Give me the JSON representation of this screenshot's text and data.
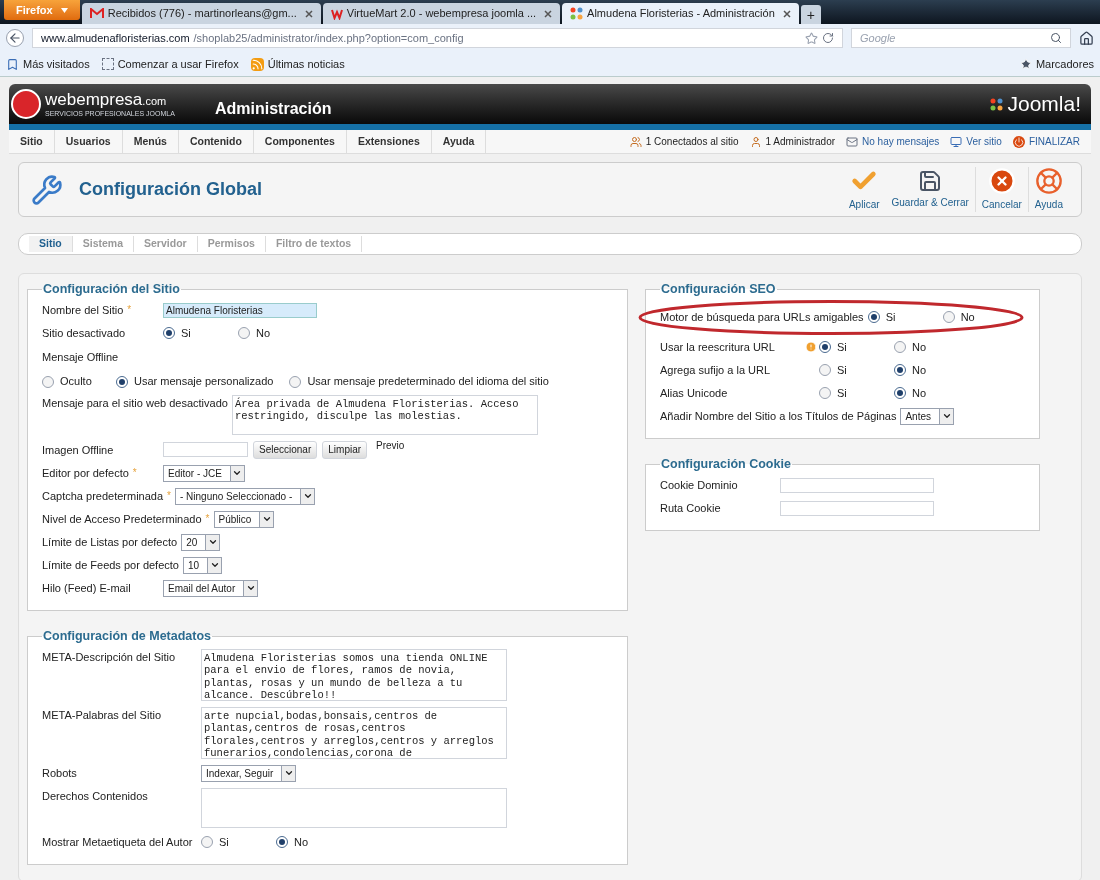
{
  "browser": {
    "menu_button": "Firefox",
    "tabs": [
      {
        "label": "Recibidos (776) - martinorleans@gm...",
        "kind": "mail",
        "selected": false
      },
      {
        "label": "VirtueMart 2.0 - webempresa joomla ...",
        "kind": "webempresa",
        "selected": false
      },
      {
        "label": "Almudena Floristerias - Administración",
        "kind": "joomla",
        "selected": true
      }
    ],
    "new_tab": "+",
    "url": {
      "host": "www.almudenafloristerias.com",
      "path": "/shoplab25/administrator/index.php?option=com_config"
    },
    "search": {
      "placeholder": "Google"
    },
    "bookmarks": [
      {
        "label": "Más visitados",
        "kind": "star"
      },
      {
        "label": "Comenzar a usar Firefox",
        "kind": "page"
      },
      {
        "label": "Últimas noticias",
        "kind": "rss"
      }
    ],
    "bookmarks_menu": "Marcadores"
  },
  "header": {
    "brand": "webempresa",
    "brand_suffix": ".com",
    "tagline": "SERVICIOS PROFESIONALES JOOMLA",
    "title": "Administración",
    "product": "Joomla!"
  },
  "menu": [
    "Sitio",
    "Usuarios",
    "Menús",
    "Contenido",
    "Componentes",
    "Extensiones",
    "Ayuda"
  ],
  "status": [
    {
      "label": "1 Conectados al sitio",
      "kind": "users"
    },
    {
      "label": "1 Administrador",
      "kind": "admin"
    },
    {
      "label": "No hay mensajes",
      "kind": "messages"
    },
    {
      "label": "Ver sitio",
      "kind": "site"
    },
    {
      "label": "FINALIZAR",
      "kind": "logout"
    }
  ],
  "toolbar": {
    "title": "Configuración Global",
    "buttons": [
      {
        "label": "Aplicar",
        "kind": "apply"
      },
      {
        "label": "Guardar & Cerrar",
        "kind": "save"
      },
      {
        "label": "Cancelar",
        "kind": "cancel"
      },
      {
        "label": "Ayuda",
        "kind": "help"
      }
    ]
  },
  "tabs": [
    {
      "label": "Sitio",
      "selected": true
    },
    {
      "label": "Sistema",
      "selected": false
    },
    {
      "label": "Servidor",
      "selected": false
    },
    {
      "label": "Permisos",
      "selected": false
    },
    {
      "label": "Filtro de textos",
      "selected": false
    }
  ],
  "left": [
    {
      "title": "Configuración del Sitio",
      "fields": [
        {
          "label": "Nombre del Sitio",
          "required": true,
          "kind": "text",
          "value": "Almudena Floristerias",
          "focused": true
        },
        {
          "label": "Sitio desactivado",
          "required": false,
          "kind": "radio",
          "options": [
            {
              "label": "Si",
              "selected": true
            },
            {
              "label": "No",
              "selected": false
            }
          ]
        },
        {
          "label": "Mensaje Offline",
          "required": false,
          "kind": "radio_block",
          "options": [
            {
              "label": "Oculto",
              "selected": false
            },
            {
              "label": "Usar mensaje personalizado",
              "selected": true
            },
            {
              "label": "Usar mensaje predeterminado del idioma del sitio",
              "selected": false
            }
          ]
        },
        {
          "label": "Mensaje para el sitio web desactivado",
          "required": false,
          "kind": "textarea",
          "value": "Área privada de Almudena Floristerias. Acceso restringido, disculpe las molestias."
        },
        {
          "label": "Imagen Offline",
          "required": false,
          "kind": "image",
          "buttons": [
            "Seleccionar",
            "Limpiar"
          ],
          "preview": "Previo"
        },
        {
          "label": "Editor por defecto",
          "required": true,
          "kind": "select",
          "value": "Editor - JCE"
        },
        {
          "label": "Captcha predeterminada",
          "required": true,
          "kind": "select",
          "value": "- Ninguno Seleccionado -"
        },
        {
          "label": "Nivel de Acceso Predeterminado",
          "required": true,
          "kind": "select",
          "value": "Público"
        },
        {
          "label": "Límite de Listas por defecto",
          "required": false,
          "kind": "select",
          "value": "20"
        },
        {
          "label": "Límite de Feeds por defecto",
          "required": false,
          "kind": "select",
          "value": "10"
        },
        {
          "label": "Hilo (Feed) E-mail",
          "required": false,
          "kind": "select",
          "value": "Email del Autor"
        }
      ]
    },
    {
      "title": "Configuración de Metadatos",
      "fields": [
        {
          "label": "META-Descripción del Sitio",
          "required": false,
          "kind": "textarea",
          "value": "Almudena Floristerias somos una tienda ONLINE para el envio de flores, ramos de novia, plantas, rosas y un mundo de belleza a tu alcance. Descúbrelo!!"
        },
        {
          "label": "META-Palabras del Sitio",
          "required": false,
          "kind": "textarea",
          "value": "arte nupcial,bodas,bonsais,centros de plantas,centros de rosas,centros florales,centros y arreglos,centros y arreglos funerarios,condolencias,corona de"
        },
        {
          "label": "Robots",
          "required": false,
          "kind": "select",
          "value": "Indexar, Seguir"
        },
        {
          "label": "Derechos Contenidos",
          "required": false,
          "kind": "textarea"
        },
        {
          "label": "Mostrar Metaetiqueta del Autor",
          "required": false,
          "kind": "radio",
          "options": [
            {
              "label": "Si",
              "selected": false
            },
            {
              "label": "No",
              "selected": true
            }
          ]
        }
      ]
    }
  ],
  "right": [
    {
      "title": "Configuración SEO",
      "highlighted": true,
      "fields": [
        {
          "label": "Motor de búsqueda para URLs amigables",
          "required": false,
          "kind": "radio",
          "options": [
            {
              "label": "Si",
              "selected": true
            },
            {
              "label": "No",
              "selected": false
            }
          ]
        },
        {
          "label": "Usar la reescritura URL",
          "required": false,
          "kind": "radio",
          "warning": true,
          "options": [
            {
              "label": "Si",
              "selected": true
            },
            {
              "label": "No",
              "selected": false
            }
          ]
        },
        {
          "label": "Agrega sufijo a la URL",
          "required": false,
          "kind": "radio",
          "options": [
            {
              "label": "Si",
              "selected": false
            },
            {
              "label": "No",
              "selected": true
            }
          ]
        },
        {
          "label": "Alias Unicode",
          "required": false,
          "kind": "radio",
          "options": [
            {
              "label": "Si",
              "selected": false
            },
            {
              "label": "No",
              "selected": true
            }
          ]
        },
        {
          "label": "Añadir Nombre del Sitio a los Títulos de Páginas",
          "required": false,
          "kind": "select",
          "value": "Antes"
        }
      ]
    },
    {
      "title": "Configuración Cookie",
      "highlighted": false,
      "fields": [
        {
          "label": "Cookie Dominio",
          "required": false,
          "kind": "text",
          "focused": false
        },
        {
          "label": "Ruta Cookie",
          "required": false,
          "kind": "text",
          "focused": false
        }
      ]
    }
  ],
  "required_marker": "*"
}
